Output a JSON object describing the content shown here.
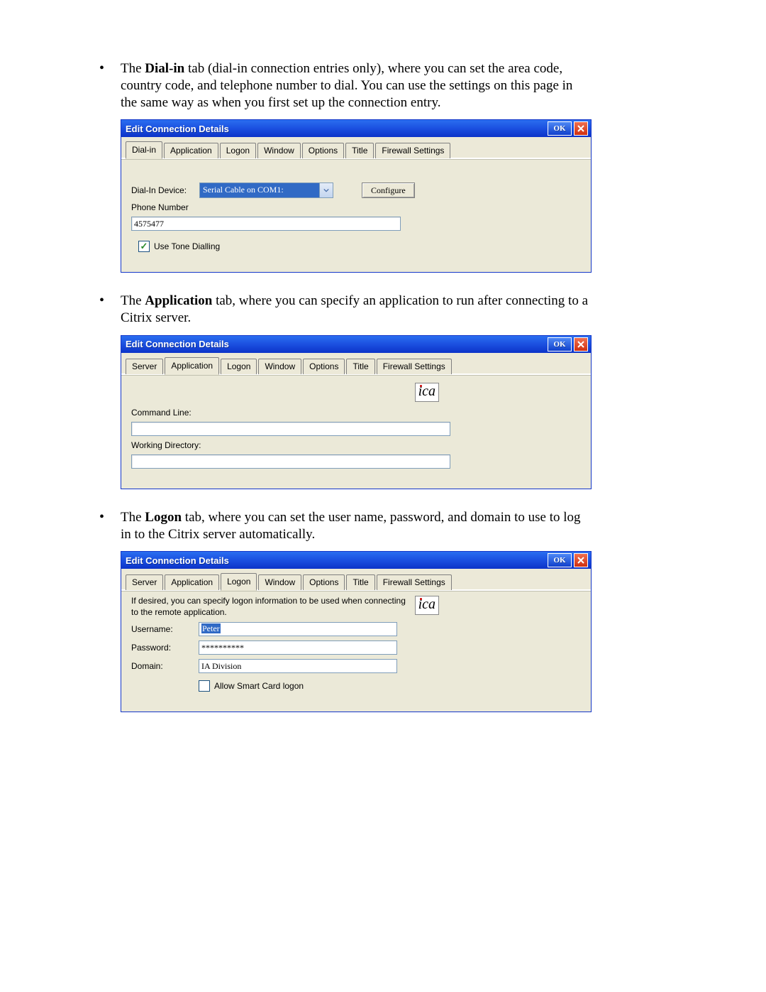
{
  "bullets": {
    "dialin": {
      "pre": "The ",
      "bold": "Dial-in",
      "post": " tab (dial-in connection entries only), where you can set the area code, country code, and telephone number to dial. You can use the settings on this page in the same way as when you first set up the connection entry."
    },
    "application": {
      "pre": "The ",
      "bold": "Application",
      "post": " tab, where you can specify an application to run after connecting to a Citrix server."
    },
    "logon": {
      "pre": "The ",
      "bold": "Logon",
      "post": " tab, where you can set the user name, password, and domain to use to log in to the Citrix server automatically."
    }
  },
  "dialog_title": "Edit Connection Details",
  "ok_label": "OK",
  "tabs_dialin": [
    "Dial-in",
    "Application",
    "Logon",
    "Window",
    "Options",
    "Title",
    "Firewall Settings"
  ],
  "tabs_server": [
    "Server",
    "Application",
    "Logon",
    "Window",
    "Options",
    "Title",
    "Firewall Settings"
  ],
  "dialin": {
    "device_label": "Dial-In Device:",
    "device_value": "Serial Cable on COM1:",
    "configure_label": "Configure",
    "phone_label": "Phone Number",
    "phone_value": "4575477",
    "tone_label": "Use Tone Dialling"
  },
  "app": {
    "cmd_label": "Command Line:",
    "cmd_value": "",
    "wd_label": "Working Directory:",
    "wd_value": "",
    "logo_text": "ica"
  },
  "logon": {
    "hint": "If desired, you can specify logon information to be used when connecting to the remote application.",
    "username_label": "Username:",
    "username_value": "Peter",
    "password_label": "Password:",
    "password_value": "**********",
    "domain_label": "Domain:",
    "domain_value": "IA Division",
    "smartcard_label": "Allow Smart Card logon",
    "logo_text": "ica"
  }
}
